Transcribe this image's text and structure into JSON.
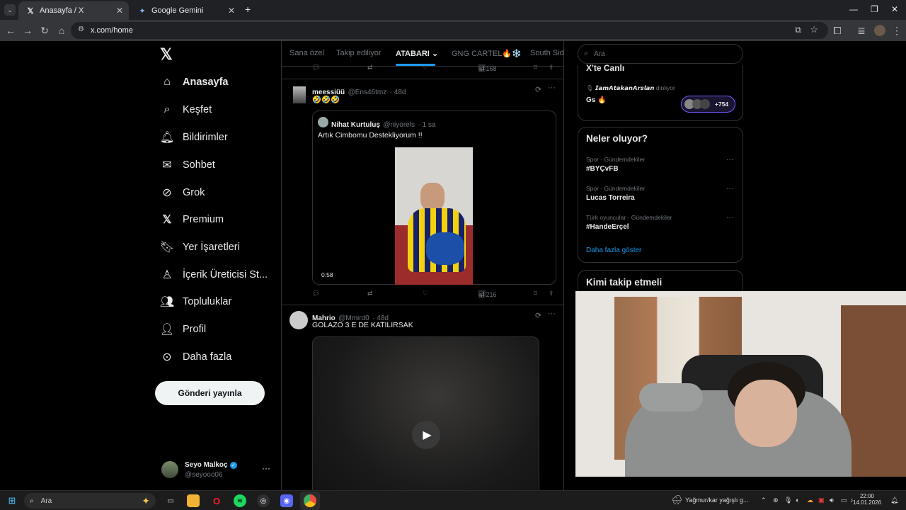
{
  "browser": {
    "tabs": [
      {
        "title": "Anasayfa / X",
        "active": true
      },
      {
        "title": "Google Gemini",
        "active": false
      }
    ],
    "url": "x.com/home"
  },
  "nav": {
    "items": [
      {
        "label": "Anasayfa",
        "icon": "home-icon"
      },
      {
        "label": "Keşfet",
        "icon": "search-icon"
      },
      {
        "label": "Bildirimler",
        "icon": "bell-icon"
      },
      {
        "label": "Sohbet",
        "icon": "mail-icon"
      },
      {
        "label": "Grok",
        "icon": "grok-icon"
      },
      {
        "label": "Premium",
        "icon": "x-logo-icon"
      },
      {
        "label": "Yer İşaretleri",
        "icon": "bookmark-icon"
      },
      {
        "label": "İçerik Üreticisi St...",
        "icon": "creator-icon"
      },
      {
        "label": "Topluluklar",
        "icon": "communities-icon"
      },
      {
        "label": "Profil",
        "icon": "person-icon"
      },
      {
        "label": "Daha fazla",
        "icon": "more-circle-icon"
      }
    ],
    "post_button": "Gönderi yayınla",
    "account": {
      "name": "Seyo Malkoç",
      "handle": "@seyooo06"
    }
  },
  "feed": {
    "tabs": [
      "Sana özel",
      "Takip ediliyor",
      "ATABARI",
      "GNG CARTEL🔥❄️",
      "South Side"
    ],
    "top_actions": {
      "views": "168"
    },
    "tweets": [
      {
        "name": "meessiüü",
        "handle": "@Ens46tmz",
        "time": "· 48d",
        "text": "🤣🤣🤣",
        "quote": {
          "name": "Nihat Kurtuluş",
          "handle": "@niyorels",
          "time": "· 1 sa",
          "text": "Artık Cimbomu Destekliyorum !!",
          "video_duration": "0:58"
        },
        "views": "216"
      },
      {
        "name": "Mahrio",
        "handle": "@Mmird0",
        "time": "· 48d",
        "text": "GOLAZO 3 E DE KATILIRSAK"
      }
    ]
  },
  "right": {
    "search_placeholder": "Ara",
    "live": {
      "title": "X'te Canlı",
      "host": "𝙄𝙖𝙢𝘼𝙩𝙖𝙠𝙖𝙣𝘼𝙧𝙨𝙡𝙖𝙣",
      "host_suffix": "dinliyor",
      "space_title": "Gs 🔥",
      "listeners": "+754"
    },
    "trends_title": "Neler oluyor?",
    "trends": [
      {
        "meta": "Spor · Gündemdekiler",
        "name": "#BYÇvFB"
      },
      {
        "meta": "Spor · Gündemdekiler",
        "name": "Lucas Torreira"
      },
      {
        "meta": "Türk oyuncular · Gündemdekiler",
        "name": "#HandeErçel"
      }
    ],
    "show_more": "Daha fazla göster",
    "who_to_follow": "Kimi takip etmeli"
  },
  "taskbar": {
    "search": "Ara",
    "weather": "Yağmur/kar yağışlı g...",
    "time": "22:00",
    "date": "14.01.2026"
  },
  "colors": {
    "accent": "#1d9bf0",
    "trend_link": "#1d9bf0",
    "verified": "#1d9bf0"
  }
}
